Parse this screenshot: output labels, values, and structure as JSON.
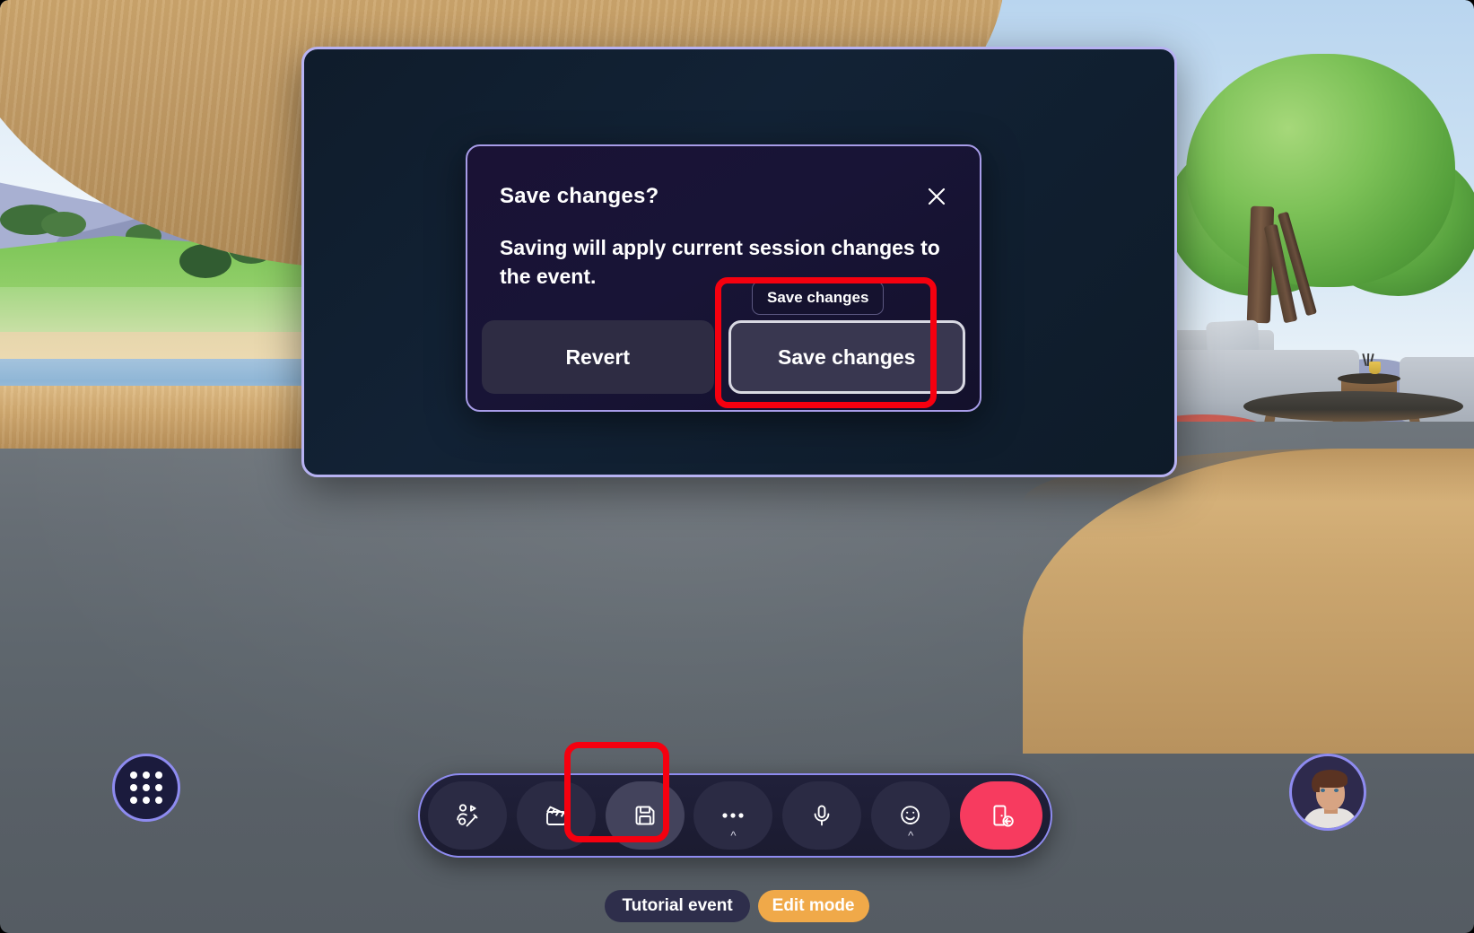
{
  "app": {
    "scene_name": "virtual-immersive-space"
  },
  "dialog": {
    "title": "Save changes?",
    "body": "Saving will apply current session changes to the event.",
    "close_icon": "close-icon",
    "buttons": {
      "revert": "Revert",
      "save": "Save changes"
    },
    "tooltip": "Save changes",
    "accent_border": "#a79ce8"
  },
  "panel": {
    "border_color": "#b7b2f2"
  },
  "annotations": {
    "highlight_color": "#f5000f",
    "save_button_box": "save-changes-highlight",
    "toolbar_save_box": "toolbar-save-highlight"
  },
  "toolbar": {
    "items": [
      {
        "name": "reactions-button",
        "icon": "person-sparkle-icon",
        "label": "",
        "state": "plain"
      },
      {
        "name": "clapperboard-button",
        "icon": "clapperboard-icon",
        "label": "",
        "state": "plain"
      },
      {
        "name": "save-button",
        "icon": "floppy-disk-save-icon",
        "label": "",
        "state": "active"
      },
      {
        "name": "more-options-button",
        "icon": "ellipsis-icon",
        "label": "",
        "state": "plain",
        "caret": "^"
      },
      {
        "name": "microphone-button",
        "icon": "microphone-icon",
        "label": "",
        "state": "plain"
      },
      {
        "name": "emoji-button",
        "icon": "smiley-face-icon",
        "label": "",
        "state": "plain",
        "caret": "^"
      },
      {
        "name": "leave-button",
        "icon": "door-exit-icon",
        "label": "",
        "state": "leave"
      }
    ],
    "border_color": "#8e8bf0"
  },
  "side_controls": {
    "apps_button": {
      "name": "apps-grid-button",
      "icon": "nine-dot-grid-icon"
    },
    "avatar_button": {
      "name": "avatar-button",
      "icon": "avatar-portrait-icon"
    }
  },
  "status_labels": {
    "event_name": "Tutorial event",
    "mode": "Edit mode",
    "mode_color": "#f0a949"
  }
}
